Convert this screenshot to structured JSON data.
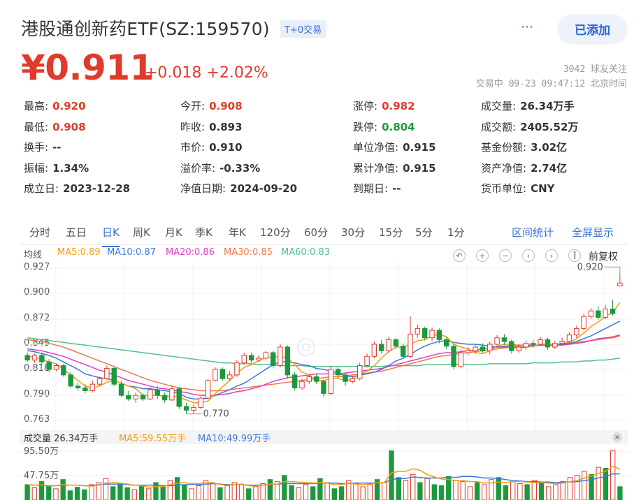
{
  "header": {
    "title": "港股通创新药ETF(SZ:159570)",
    "badge": "T+0交易",
    "more_icon": "⋯",
    "add_label": "已添加",
    "price": "¥0.911",
    "change": "+0.018 +2.02%",
    "followers": "3042 球友关注",
    "trade_time": "交易中 09-23 09:47:12 北京时间"
  },
  "stats": [
    [
      {
        "label": "最高:",
        "value": "0.920",
        "color": "red"
      },
      {
        "label": "今开:",
        "value": "0.908",
        "color": "red"
      },
      {
        "label": "涨停:",
        "value": "0.982",
        "color": "red"
      },
      {
        "label": "成交量:",
        "value": "26.34万手",
        "color": ""
      }
    ],
    [
      {
        "label": "最低:",
        "value": "0.908",
        "color": "red"
      },
      {
        "label": "昨收:",
        "value": "0.893",
        "color": ""
      },
      {
        "label": "跌停:",
        "value": "0.804",
        "color": "green"
      },
      {
        "label": "成交额:",
        "value": "2405.52万",
        "color": ""
      }
    ],
    [
      {
        "label": "换手:",
        "value": "--",
        "color": ""
      },
      {
        "label": "市价:",
        "value": "0.910",
        "color": ""
      },
      {
        "label": "单位净值:",
        "value": "0.915",
        "color": ""
      },
      {
        "label": "基金份额:",
        "value": "3.02亿",
        "color": ""
      }
    ],
    [
      {
        "label": "振幅:",
        "value": "1.34%",
        "color": ""
      },
      {
        "label": "溢价率:",
        "value": "-0.33%",
        "color": ""
      },
      {
        "label": "累计净值:",
        "value": "0.915",
        "color": ""
      },
      {
        "label": "资产净值:",
        "value": "2.74亿",
        "color": ""
      }
    ],
    [
      {
        "label": "成立日:",
        "value": "2023-12-28",
        "color": ""
      },
      {
        "label": "净值日期:",
        "value": "2024-09-20",
        "color": ""
      },
      {
        "label": "到期日:",
        "value": "--",
        "color": ""
      },
      {
        "label": "货币单位:",
        "value": "CNY",
        "color": ""
      }
    ]
  ],
  "tabs": [
    "分时",
    "五日",
    "日K",
    "周K",
    "月K",
    "季K",
    "年K",
    "120分",
    "60分",
    "30分",
    "15分",
    "5分",
    "1分"
  ],
  "active_tab": "日K",
  "tab_links": [
    "区间统计",
    "全屏显示"
  ],
  "ma_legend": {
    "label": "均线",
    "items": [
      {
        "text": "MA5:0.89",
        "color": "#f39c12"
      },
      {
        "text": "MA10:0.87",
        "color": "#3d7bd9"
      },
      {
        "text": "MA20:0.86",
        "color": "#e040c0"
      },
      {
        "text": "MA30:0.85",
        "color": "#f0784a"
      },
      {
        "text": "MA60:0.83",
        "color": "#52c08a"
      }
    ]
  },
  "controls": [
    "↶",
    "+",
    "−",
    "‹",
    "›",
    "⫿"
  ],
  "adjust_label": "前复权",
  "y_axis": [
    "0.927",
    "0.900",
    "0.872",
    "0.845",
    "0.818",
    "0.790",
    "0.763"
  ],
  "max_marker": "0.920",
  "min_marker": "0.770",
  "volume_legend": {
    "items": [
      {
        "text": "成交量 26.34万手",
        "color": "#333"
      },
      {
        "text": "MA5:59.55万手",
        "color": "#f39c12"
      },
      {
        "text": "MA10:49.99万手",
        "color": "#3d7bd9"
      }
    ],
    "close_icon": "×"
  },
  "volume_axis": [
    "95.50万",
    "47.75万"
  ],
  "colors": {
    "up": "#e03a2b",
    "down": "#1a9a3c",
    "accent": "#3b6fd6"
  },
  "chart_data": {
    "type": "candlestick",
    "ylim": [
      0.763,
      0.927
    ],
    "candles": [
      [
        0.833,
        0.828,
        0.836,
        0.826
      ],
      [
        0.828,
        0.833,
        0.835,
        0.825
      ],
      [
        0.833,
        0.826,
        0.836,
        0.823
      ],
      [
        0.826,
        0.818,
        0.829,
        0.815
      ],
      [
        0.818,
        0.822,
        0.824,
        0.816
      ],
      [
        0.822,
        0.812,
        0.824,
        0.81
      ],
      [
        0.812,
        0.8,
        0.815,
        0.798
      ],
      [
        0.8,
        0.798,
        0.804,
        0.795
      ],
      [
        0.798,
        0.795,
        0.802,
        0.792
      ],
      [
        0.795,
        0.802,
        0.806,
        0.793
      ],
      [
        0.802,
        0.808,
        0.81,
        0.8
      ],
      [
        0.808,
        0.819,
        0.822,
        0.806
      ],
      [
        0.819,
        0.802,
        0.821,
        0.8
      ],
      [
        0.802,
        0.79,
        0.805,
        0.788
      ],
      [
        0.79,
        0.786,
        0.795,
        0.784
      ],
      [
        0.786,
        0.79,
        0.793,
        0.782
      ],
      [
        0.79,
        0.786,
        0.792,
        0.784
      ],
      [
        0.786,
        0.796,
        0.799,
        0.785
      ],
      [
        0.796,
        0.79,
        0.8,
        0.786
      ],
      [
        0.79,
        0.785,
        0.793,
        0.782
      ],
      [
        0.785,
        0.797,
        0.8,
        0.784
      ],
      [
        0.797,
        0.778,
        0.799,
        0.775
      ],
      [
        0.778,
        0.774,
        0.782,
        0.77
      ],
      [
        0.774,
        0.777,
        0.78,
        0.77
      ],
      [
        0.777,
        0.787,
        0.789,
        0.775
      ],
      [
        0.787,
        0.806,
        0.808,
        0.786
      ],
      [
        0.806,
        0.818,
        0.82,
        0.805
      ],
      [
        0.818,
        0.808,
        0.82,
        0.806
      ],
      [
        0.808,
        0.812,
        0.816,
        0.806
      ],
      [
        0.812,
        0.825,
        0.828,
        0.81
      ],
      [
        0.825,
        0.833,
        0.836,
        0.823
      ],
      [
        0.833,
        0.828,
        0.836,
        0.825
      ],
      [
        0.828,
        0.83,
        0.833,
        0.826
      ],
      [
        0.83,
        0.836,
        0.838,
        0.828
      ],
      [
        0.836,
        0.822,
        0.838,
        0.819
      ],
      [
        0.822,
        0.842,
        0.845,
        0.82
      ],
      [
        0.842,
        0.812,
        0.844,
        0.808
      ],
      [
        0.812,
        0.798,
        0.815,
        0.795
      ],
      [
        0.798,
        0.805,
        0.808,
        0.796
      ],
      [
        0.805,
        0.81,
        0.813,
        0.802
      ],
      [
        0.81,
        0.805,
        0.813,
        0.802
      ],
      [
        0.805,
        0.792,
        0.807,
        0.788
      ],
      [
        0.792,
        0.818,
        0.822,
        0.79
      ],
      [
        0.818,
        0.812,
        0.82,
        0.808
      ],
      [
        0.812,
        0.805,
        0.815,
        0.8
      ],
      [
        0.805,
        0.808,
        0.811,
        0.803
      ],
      [
        0.808,
        0.822,
        0.825,
        0.806
      ],
      [
        0.822,
        0.832,
        0.835,
        0.82
      ],
      [
        0.832,
        0.845,
        0.848,
        0.83
      ],
      [
        0.845,
        0.838,
        0.85,
        0.835
      ],
      [
        0.838,
        0.85,
        0.853,
        0.836
      ],
      [
        0.85,
        0.843,
        0.852,
        0.84
      ],
      [
        0.843,
        0.832,
        0.846,
        0.829
      ],
      [
        0.832,
        0.856,
        0.875,
        0.83
      ],
      [
        0.856,
        0.862,
        0.866,
        0.852
      ],
      [
        0.862,
        0.852,
        0.864,
        0.849
      ],
      [
        0.852,
        0.86,
        0.863,
        0.848
      ],
      [
        0.86,
        0.85,
        0.862,
        0.846
      ],
      [
        0.85,
        0.843,
        0.853,
        0.84
      ],
      [
        0.843,
        0.821,
        0.846,
        0.818
      ],
      [
        0.821,
        0.836,
        0.84,
        0.819
      ],
      [
        0.836,
        0.838,
        0.842,
        0.833
      ],
      [
        0.838,
        0.842,
        0.845,
        0.835
      ],
      [
        0.842,
        0.838,
        0.846,
        0.836
      ],
      [
        0.838,
        0.845,
        0.848,
        0.834
      ],
      [
        0.845,
        0.852,
        0.855,
        0.842
      ],
      [
        0.852,
        0.848,
        0.856,
        0.844
      ],
      [
        0.848,
        0.838,
        0.85,
        0.835
      ],
      [
        0.838,
        0.842,
        0.845,
        0.836
      ],
      [
        0.842,
        0.846,
        0.849,
        0.839
      ],
      [
        0.846,
        0.845,
        0.85,
        0.841
      ],
      [
        0.845,
        0.85,
        0.853,
        0.843
      ],
      [
        0.85,
        0.842,
        0.852,
        0.839
      ],
      [
        0.842,
        0.846,
        0.849,
        0.84
      ],
      [
        0.846,
        0.848,
        0.852,
        0.844
      ],
      [
        0.848,
        0.855,
        0.858,
        0.846
      ],
      [
        0.855,
        0.862,
        0.865,
        0.852
      ],
      [
        0.862,
        0.875,
        0.878,
        0.86
      ],
      [
        0.875,
        0.881,
        0.884,
        0.872
      ],
      [
        0.881,
        0.874,
        0.886,
        0.871
      ],
      [
        0.874,
        0.883,
        0.887,
        0.872
      ],
      [
        0.883,
        0.878,
        0.893,
        0.876
      ],
      [
        0.908,
        0.911,
        0.92,
        0.908
      ]
    ],
    "ma5": [
      0.832,
      0.831,
      0.829,
      0.826,
      0.824,
      0.818,
      0.812,
      0.806,
      0.8,
      0.798,
      0.8,
      0.804,
      0.806,
      0.803,
      0.8,
      0.797,
      0.79,
      0.79,
      0.79,
      0.789,
      0.789,
      0.788,
      0.785,
      0.782,
      0.782,
      0.784,
      0.792,
      0.799,
      0.806,
      0.814,
      0.82,
      0.823,
      0.827,
      0.831,
      0.831,
      0.832,
      0.83,
      0.823,
      0.815,
      0.812,
      0.806,
      0.806,
      0.808,
      0.808,
      0.806,
      0.807,
      0.813,
      0.816,
      0.822,
      0.83,
      0.837,
      0.842,
      0.842,
      0.845,
      0.849,
      0.85,
      0.854,
      0.856,
      0.853,
      0.845,
      0.842,
      0.84,
      0.836,
      0.835,
      0.838,
      0.843,
      0.845,
      0.845,
      0.844,
      0.843,
      0.843,
      0.845,
      0.845,
      0.845,
      0.846,
      0.847,
      0.851,
      0.857,
      0.864,
      0.869,
      0.875,
      0.879,
      0.89
    ],
    "ma10": [
      0.838,
      0.837,
      0.835,
      0.833,
      0.83,
      0.826,
      0.822,
      0.818,
      0.813,
      0.811,
      0.809,
      0.808,
      0.806,
      0.803,
      0.8,
      0.799,
      0.797,
      0.797,
      0.796,
      0.795,
      0.794,
      0.792,
      0.788,
      0.786,
      0.786,
      0.787,
      0.79,
      0.793,
      0.796,
      0.8,
      0.803,
      0.808,
      0.813,
      0.818,
      0.823,
      0.826,
      0.826,
      0.825,
      0.823,
      0.822,
      0.819,
      0.818,
      0.816,
      0.814,
      0.811,
      0.81,
      0.812,
      0.813,
      0.815,
      0.818,
      0.822,
      0.827,
      0.83,
      0.834,
      0.839,
      0.843,
      0.846,
      0.848,
      0.849,
      0.847,
      0.846,
      0.845,
      0.845,
      0.844,
      0.843,
      0.842,
      0.842,
      0.842,
      0.841,
      0.842,
      0.843,
      0.844,
      0.845,
      0.845,
      0.845,
      0.846,
      0.848,
      0.851,
      0.854,
      0.858,
      0.862,
      0.866,
      0.87
    ],
    "ma20": [
      0.84,
      0.839,
      0.838,
      0.836,
      0.834,
      0.832,
      0.829,
      0.826,
      0.823,
      0.82,
      0.817,
      0.815,
      0.812,
      0.809,
      0.806,
      0.804,
      0.802,
      0.8,
      0.798,
      0.797,
      0.796,
      0.794,
      0.793,
      0.791,
      0.79,
      0.79,
      0.79,
      0.791,
      0.792,
      0.794,
      0.795,
      0.797,
      0.799,
      0.802,
      0.805,
      0.807,
      0.809,
      0.81,
      0.811,
      0.812,
      0.813,
      0.813,
      0.813,
      0.813,
      0.814,
      0.815,
      0.816,
      0.817,
      0.818,
      0.819,
      0.821,
      0.823,
      0.825,
      0.827,
      0.829,
      0.831,
      0.833,
      0.835,
      0.836,
      0.836,
      0.837,
      0.838,
      0.839,
      0.84,
      0.841,
      0.842,
      0.843,
      0.844,
      0.844,
      0.844,
      0.844,
      0.844,
      0.844,
      0.844,
      0.844,
      0.845,
      0.846,
      0.847,
      0.849,
      0.851,
      0.852,
      0.853,
      0.855
    ],
    "ma30": [
      0.85,
      0.849,
      0.848,
      0.846,
      0.844,
      0.842,
      0.839,
      0.836,
      0.833,
      0.83,
      0.827,
      0.824,
      0.821,
      0.818,
      0.815,
      0.812,
      0.809,
      0.806,
      0.804,
      0.802,
      0.8,
      0.798,
      0.797,
      0.796,
      0.795,
      0.795,
      0.795,
      0.795,
      0.796,
      0.797,
      0.798,
      0.799,
      0.8,
      0.801,
      0.802,
      0.803,
      0.804,
      0.805,
      0.806,
      0.807,
      0.808,
      0.809,
      0.81,
      0.81,
      0.811,
      0.812,
      0.813,
      0.814,
      0.815,
      0.816,
      0.818,
      0.82,
      0.822,
      0.824,
      0.826,
      0.828,
      0.83,
      0.832,
      0.833,
      0.834,
      0.835,
      0.836,
      0.837,
      0.838,
      0.839,
      0.84,
      0.841,
      0.842,
      0.843,
      0.843,
      0.844,
      0.844,
      0.844,
      0.845,
      0.845,
      0.846,
      0.847,
      0.848,
      0.849,
      0.85,
      0.851,
      0.852,
      0.854
    ],
    "ma60": [
      0.852,
      0.851,
      0.85,
      0.849,
      0.848,
      0.847,
      0.846,
      0.845,
      0.844,
      0.843,
      0.842,
      0.841,
      0.84,
      0.839,
      0.838,
      0.837,
      0.836,
      0.835,
      0.834,
      0.833,
      0.832,
      0.831,
      0.83,
      0.829,
      0.828,
      0.827,
      0.826,
      0.825,
      0.825,
      0.824,
      0.824,
      0.824,
      0.823,
      0.823,
      0.823,
      0.822,
      0.822,
      0.822,
      0.822,
      0.821,
      0.821,
      0.821,
      0.821,
      0.821,
      0.821,
      0.821,
      0.821,
      0.821,
      0.821,
      0.821,
      0.822,
      0.822,
      0.822,
      0.822,
      0.822,
      0.823,
      0.823,
      0.823,
      0.823,
      0.823,
      0.823,
      0.823,
      0.823,
      0.823,
      0.824,
      0.824,
      0.824,
      0.824,
      0.824,
      0.824,
      0.825,
      0.825,
      0.825,
      0.825,
      0.826,
      0.826,
      0.826,
      0.827,
      0.827,
      0.828,
      0.828,
      0.829,
      0.83
    ],
    "volume_ylim": [
      0,
      95.5
    ],
    "volumes": [
      30,
      24,
      36,
      28,
      22,
      40,
      18,
      25,
      20,
      30,
      34,
      42,
      26,
      30,
      24,
      20,
      28,
      22,
      34,
      26,
      38,
      44,
      30,
      22,
      28,
      38,
      32,
      24,
      28,
      34,
      30,
      22,
      26,
      32,
      40,
      36,
      48,
      28,
      24,
      30,
      26,
      42,
      34,
      22,
      26,
      38,
      32,
      26,
      30,
      40,
      34,
      96,
      44,
      38,
      50,
      34,
      42,
      30,
      28,
      46,
      38,
      36,
      26,
      34,
      30,
      40,
      44,
      28,
      36,
      32,
      30,
      38,
      34,
      26,
      30,
      36,
      44,
      48,
      56,
      50,
      64,
      62,
      96,
      26
    ],
    "vol_ma5": [
      30,
      29,
      30,
      28,
      28,
      30,
      29,
      29,
      28,
      27,
      29,
      33,
      34,
      33,
      31,
      29,
      28,
      25,
      26,
      26,
      30,
      33,
      34,
      32,
      32,
      34,
      34,
      30,
      29,
      30,
      31,
      28,
      27,
      29,
      31,
      31,
      36,
      36,
      35,
      34,
      33,
      34,
      33,
      30,
      30,
      33,
      31,
      30,
      31,
      34,
      34,
      53,
      56,
      56,
      61,
      58,
      50,
      45,
      41,
      40,
      38,
      38,
      36,
      36,
      33,
      33,
      35,
      34,
      36,
      36,
      35,
      34,
      34,
      33,
      32,
      33,
      36,
      38,
      43,
      47,
      52,
      56,
      66,
      60
    ],
    "vol_ma10": [
      30,
      29,
      29,
      28,
      28,
      29,
      29,
      29,
      28,
      28,
      30,
      31,
      31,
      31,
      30,
      29,
      29,
      29,
      29,
      28,
      28,
      29,
      30,
      30,
      30,
      31,
      32,
      31,
      30,
      30,
      30,
      29,
      29,
      29,
      30,
      31,
      32,
      32,
      32,
      32,
      32,
      33,
      33,
      33,
      32,
      32,
      33,
      33,
      33,
      33,
      34,
      40,
      42,
      42,
      45,
      44,
      43,
      43,
      43,
      45,
      44,
      46,
      46,
      45,
      43,
      43,
      42,
      40,
      38,
      37,
      36,
      36,
      35,
      35,
      34,
      35,
      35,
      36,
      38,
      40,
      43,
      46,
      51,
      51
    ]
  }
}
